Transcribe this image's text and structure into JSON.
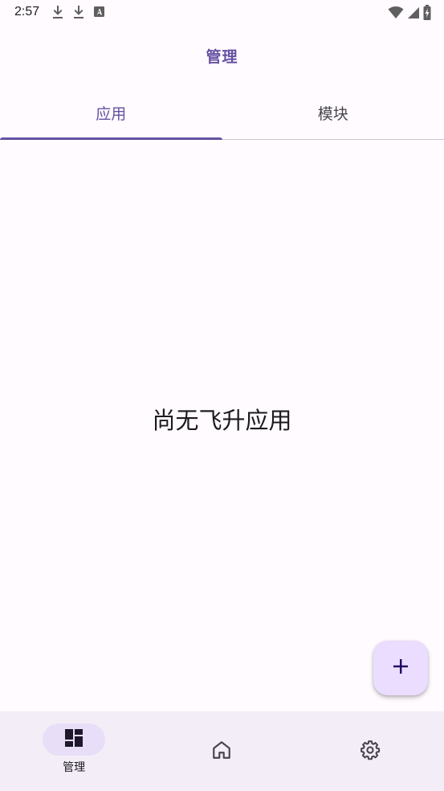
{
  "status_bar": {
    "time": "2:57",
    "left_icons": [
      "download-icon",
      "download-icon",
      "text-a-icon"
    ],
    "right_icons": [
      "wifi-icon",
      "signal-icon",
      "battery-charging-icon"
    ]
  },
  "app_bar": {
    "title": "管理"
  },
  "tabs": [
    {
      "label": "应用",
      "active": true
    },
    {
      "label": "模块",
      "active": false
    }
  ],
  "main": {
    "empty_message": "尚无飞升应用"
  },
  "fab": {
    "icon": "plus-icon"
  },
  "bottom_nav": {
    "items": [
      {
        "label": "管理",
        "icon": "dashboard-icon",
        "selected": true
      },
      {
        "icon": "home-icon",
        "selected": false
      },
      {
        "icon": "gear-icon",
        "selected": false
      }
    ]
  },
  "colors": {
    "accent": "#6750a4",
    "background": "#fffbfe",
    "nav_background": "#f3edf7",
    "fab_background": "#eaddff",
    "nav_pill": "#e8def8"
  }
}
